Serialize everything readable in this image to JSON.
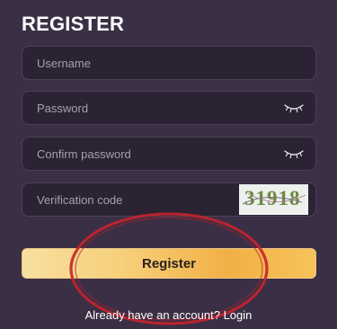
{
  "page": {
    "title": "REGISTER"
  },
  "form": {
    "username_placeholder": "Username",
    "password_placeholder": "Password",
    "confirm_placeholder": "Confirm password",
    "verification_placeholder": "Verification code",
    "captcha_code": "31918",
    "register_label": "Register"
  },
  "footer": {
    "prompt": "Already have an account?",
    "login_label": "Login"
  },
  "icons": {
    "password_toggle": "eye-closed-icon",
    "confirm_toggle": "eye-closed-icon"
  },
  "colors": {
    "background": "#3b2f45",
    "field_background": "#2b2334",
    "button_gradient_start": "#f8dfa0",
    "button_gradient_end": "#f2b046",
    "annotation_circle": "#c4232c"
  }
}
